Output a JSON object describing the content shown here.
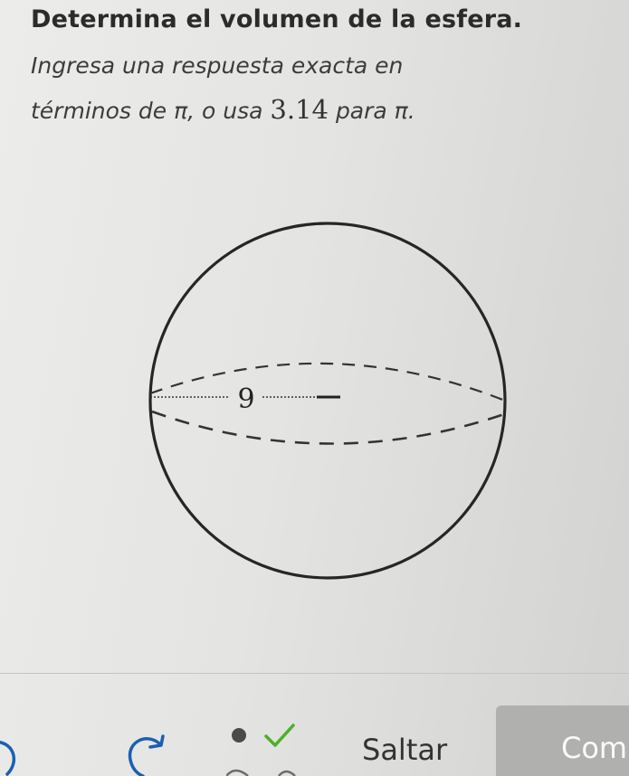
{
  "question": {
    "title": "Determina el volumen de la esfera.",
    "instruction_part1": "Ingresa una respuesta exacta en",
    "instruction_part2": "términos de π, o usa",
    "pi_approx": "3.14",
    "instruction_part3": "para π."
  },
  "figure": {
    "shape": "sphere",
    "radius_label": "9"
  },
  "footer": {
    "skip_label": "Saltar",
    "check_label": "Com"
  },
  "icons": {
    "undo": "undo-icon",
    "redo": "redo-icon",
    "streak_dot": "dot-icon",
    "checkmark": "checkmark-icon"
  },
  "colors": {
    "checkmark": "#4caf2a",
    "check_button_bg": "#b0b0ae"
  }
}
